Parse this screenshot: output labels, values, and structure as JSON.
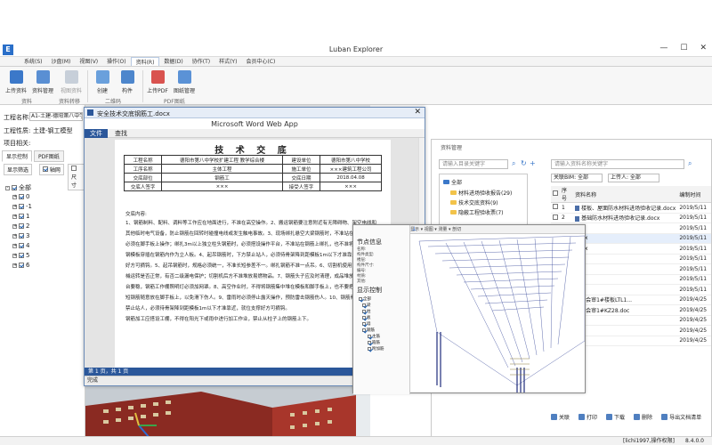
{
  "app": {
    "title": "Luban Explorer",
    "version": "8.4.0.0",
    "logo": "E"
  },
  "menu": [
    "系统(S)",
    "沙盘(M)",
    "视图(V)",
    "操作(O)",
    "资料(R)",
    "数据(D)",
    "协作(T)",
    "样式(Y)",
    "会员中心(C)"
  ],
  "ribbon": {
    "buttons": [
      "上传资料",
      "资料管理",
      "视图资料",
      "创建",
      "构件",
      "上传PDF",
      "图纸管理"
    ],
    "groups": [
      "资料",
      "资料转移",
      "二维码",
      "PDF图纸"
    ]
  },
  "left": {
    "project_label": "工程名称:",
    "project_value": "A1-土建-德阳第八中学",
    "type_label": "工程性质:",
    "type_value": "土建-钢工模型",
    "related_label": "项目相关:",
    "tabs": [
      "显示控制",
      "PDF图纸"
    ],
    "tools": [
      "显示筛选",
      "轴网",
      "尺寸"
    ],
    "tree": [
      "全部",
      "0",
      "-1",
      "1",
      "2",
      "3",
      "4",
      "5",
      "6"
    ]
  },
  "word": {
    "filename": "安全技术交底钢筋工.docx",
    "app_title": "Microsoft Word Web App",
    "tabs": [
      "文件",
      "查找"
    ],
    "heading": "技 术 交 底",
    "table": [
      [
        "工程名称",
        "德阳市第八中学校扩建工程 教学综合楼",
        "建设单位",
        "德阳市第八中学校"
      ],
      [
        "工序名称",
        "主体工程",
        "施工单位",
        "×××建筑工程公司"
      ],
      [
        "交底部位",
        "钢筋工",
        "交底日期",
        "2018.04.08"
      ],
      [
        "交底人签字",
        "×××",
        "接受人签字",
        "×××"
      ]
    ],
    "content_label": "交底内容:",
    "lines": [
      "1、钢筋制料、配料、调料等工作应在地面进行，不准在高空操作。2、搬运钢筋要注意附近有无障碍物、架空电线和",
      "其他临时电气设备，防止钢筋在回转时碰撞电线或发生触电事故。3、现场绑扎悬空大梁钢筋时，不准站在模板上操作，",
      "必须在脚手板上操作；绑扎3m以上独立柱头钢筋时，必须搭设操作平台，不准站在钢筋上绑扎，也不准将木料、管子、",
      "钢模板穿插在钢筋内作为立人板。4、起吊钢筋时，下方禁止站人，必须待骨架降到距模板1m以下才准靠近，就位支撑",
      "好方可摘钩。5、起吊钢筋时，规格必须统一，不准长短参差不一。绑扎钢筋不准一点吊。6、切割机使用前，须检查机",
      "械运转是否正常，有否二级漏电保护；切割机后方不准堆放易燃物品。7、钢筋头子应及时清理，成品堆放要整齐，工作",
      "台要稳，钢筋工作棚照明灯必须加网罩。8、高空作业时，不得将钢筋集中堆在模板和脚手板上，也不要把工具、钢箍、",
      "短钢筋随意放在脚手板上，以免滑下伤人。9、雷雨时必须停止露天操作，预防雷击钢筋伤人。10、钢筋骨架安装，下方",
      "禁止站人，必须待骨架降到距模板1m以下才准靠近，就位支撑好方可摘钩。",
      "钢筋加工应搭设工棚，不得在阳光下或雨中进行加工作业，禁止从柱子上的钢筋上下。"
    ],
    "page_status": "第 1 页，共 1 页",
    "ready_status": "完成"
  },
  "filemgr": {
    "title": "资料管理",
    "search_placeholder": "请输入目录关键字",
    "search2_placeholder": "请输入资料名称关键字",
    "tree": [
      "全部",
      "材料进场验收报告(29)",
      "技术交底资料(9)",
      "隐蔽工程验收票(7)"
    ],
    "filter1": "关联BIM: 全部",
    "filter2": "上传人: 全部",
    "columns": [
      "",
      "序号",
      "资料名称",
      "编制时间"
    ],
    "rows": [
      [
        "1",
        "楼板、屋面防水材料进场验收记录.docx",
        "2019/5/11"
      ],
      [
        "2",
        "基础防水材料进场验收记录.docx",
        "2019/5/11"
      ],
      [
        "3",
        "cx",
        "2019/5/11"
      ],
      [
        "4",
        "docx",
        "2019/5/11"
      ],
      [
        "5",
        "docx",
        "2019/5/11"
      ],
      [
        "6",
        "cx",
        "2019/5/11"
      ],
      [
        "7",
        "cx",
        "2019/5/11"
      ],
      [
        "8",
        "cx",
        "2019/5/11"
      ],
      [
        "9",
        "cx",
        "2019/5/11"
      ],
      [
        "10",
        "钢筋会审1#楼板LTL1...",
        "2019/4/25"
      ],
      [
        "11",
        "资料会审1#KZ28.doc",
        "2019/4/25"
      ],
      [
        "12",
        "cx",
        "2019/4/25"
      ],
      [
        "13",
        "cx",
        "2019/4/25"
      ],
      [
        "14",
        "cx",
        "2019/4/25"
      ]
    ],
    "footer": [
      "关联",
      "打印",
      "下载",
      "删除",
      "导出文档清单"
    ]
  },
  "model": {
    "node_title": "节点信息",
    "node_rows": [
      "名称:",
      "构件类型:",
      "楼层:",
      "构件尺寸:",
      "编号:",
      "材质:",
      "其他:"
    ],
    "display_title": "显示控制",
    "display_tree": [
      "全部",
      "梁",
      "柱",
      "板",
      "墙",
      "钢筋",
      "主筋",
      "箍筋",
      "附加筋"
    ],
    "toolbar_text": "显示 ▾  视图 ▾  测量 ▾  剖切"
  },
  "status": {
    "login": "[lichi1997,操作权限]",
    "version": "8.4.0.0"
  }
}
